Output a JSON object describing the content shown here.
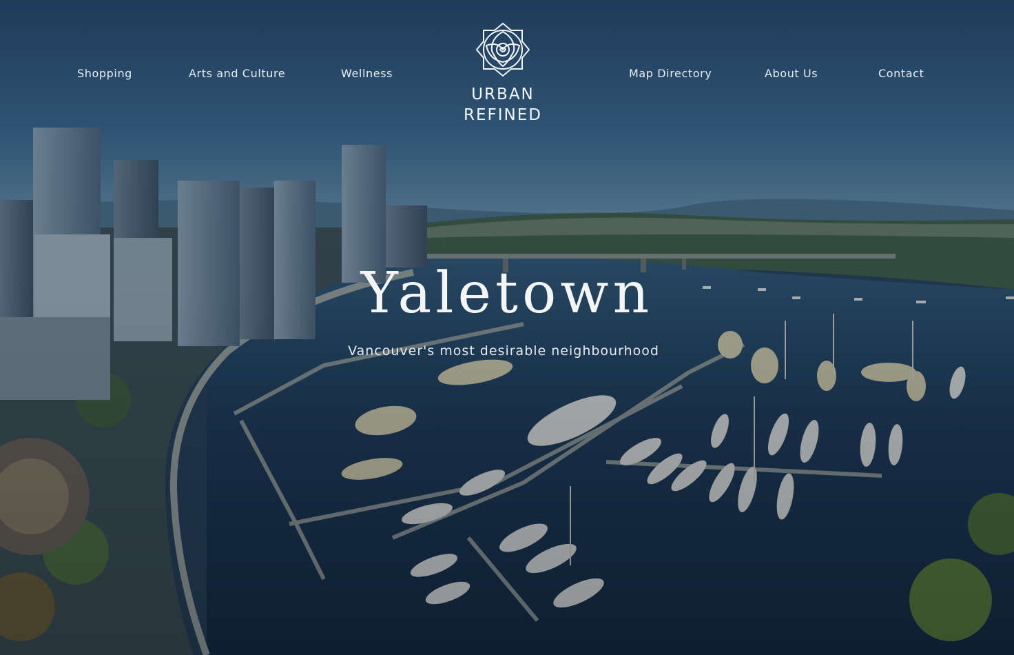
{
  "page": {
    "title": "Yaletown",
    "subtitle": "Vancouver's most desirable neighbourhood"
  },
  "brand": {
    "line1": "URBAN",
    "line2": "REFINED",
    "logo_icon": "rose-emblem-icon"
  },
  "nav": {
    "left": [
      {
        "label": "Shopping"
      },
      {
        "label": "Arts and Culture"
      },
      {
        "label": "Wellness"
      }
    ],
    "right": [
      {
        "label": "Map Directory"
      },
      {
        "label": "About Us"
      },
      {
        "label": "Contact"
      }
    ]
  },
  "hero_image": {
    "subject": "aerial-marina-cityscape",
    "accent": "#1e3a58"
  },
  "colors": {
    "text": "#f4f5f6",
    "sky": "#3a6688",
    "water": "#142a40"
  }
}
